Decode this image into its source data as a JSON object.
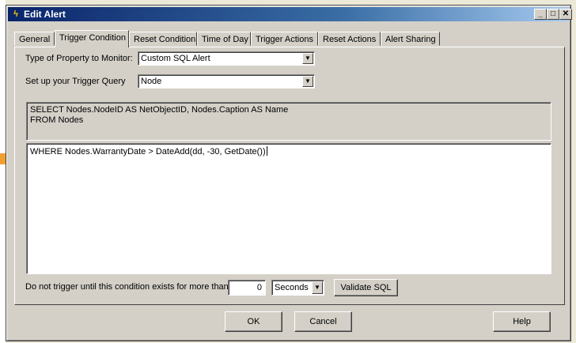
{
  "window": {
    "title": "Edit Alert"
  },
  "title_buttons": {
    "minimize": "_",
    "maximize": "□",
    "close": "✕"
  },
  "tabs": [
    {
      "label": "General"
    },
    {
      "label": "Trigger Condition",
      "active": true
    },
    {
      "label": "Reset Condition"
    },
    {
      "label": "Time of Day"
    },
    {
      "label": "Trigger Actions"
    },
    {
      "label": "Reset Actions"
    },
    {
      "label": "Alert Sharing"
    }
  ],
  "trigger": {
    "property_label": "Type of Property to Monitor:",
    "property_value": "Custom SQL Alert",
    "query_label": "Set up your Trigger Query",
    "query_value": "Node",
    "sql_line1": "SELECT Nodes.NodeID AS NetObjectID, Nodes.Caption AS Name",
    "sql_line2": "FROM Nodes",
    "where_clause": "WHERE Nodes.WarrantyDate > DateAdd(dd, -30, GetDate())",
    "duration_label": "Do not trigger until this condition exists for more than",
    "duration_value": "0",
    "duration_unit": "Seconds",
    "validate_label": "Validate SQL"
  },
  "footer": {
    "ok_label": "OK",
    "cancel_label": "Cancel",
    "help_label": "Help"
  },
  "icons": {
    "app": "lightning-icon",
    "dropdown": "chevron-down-icon"
  }
}
